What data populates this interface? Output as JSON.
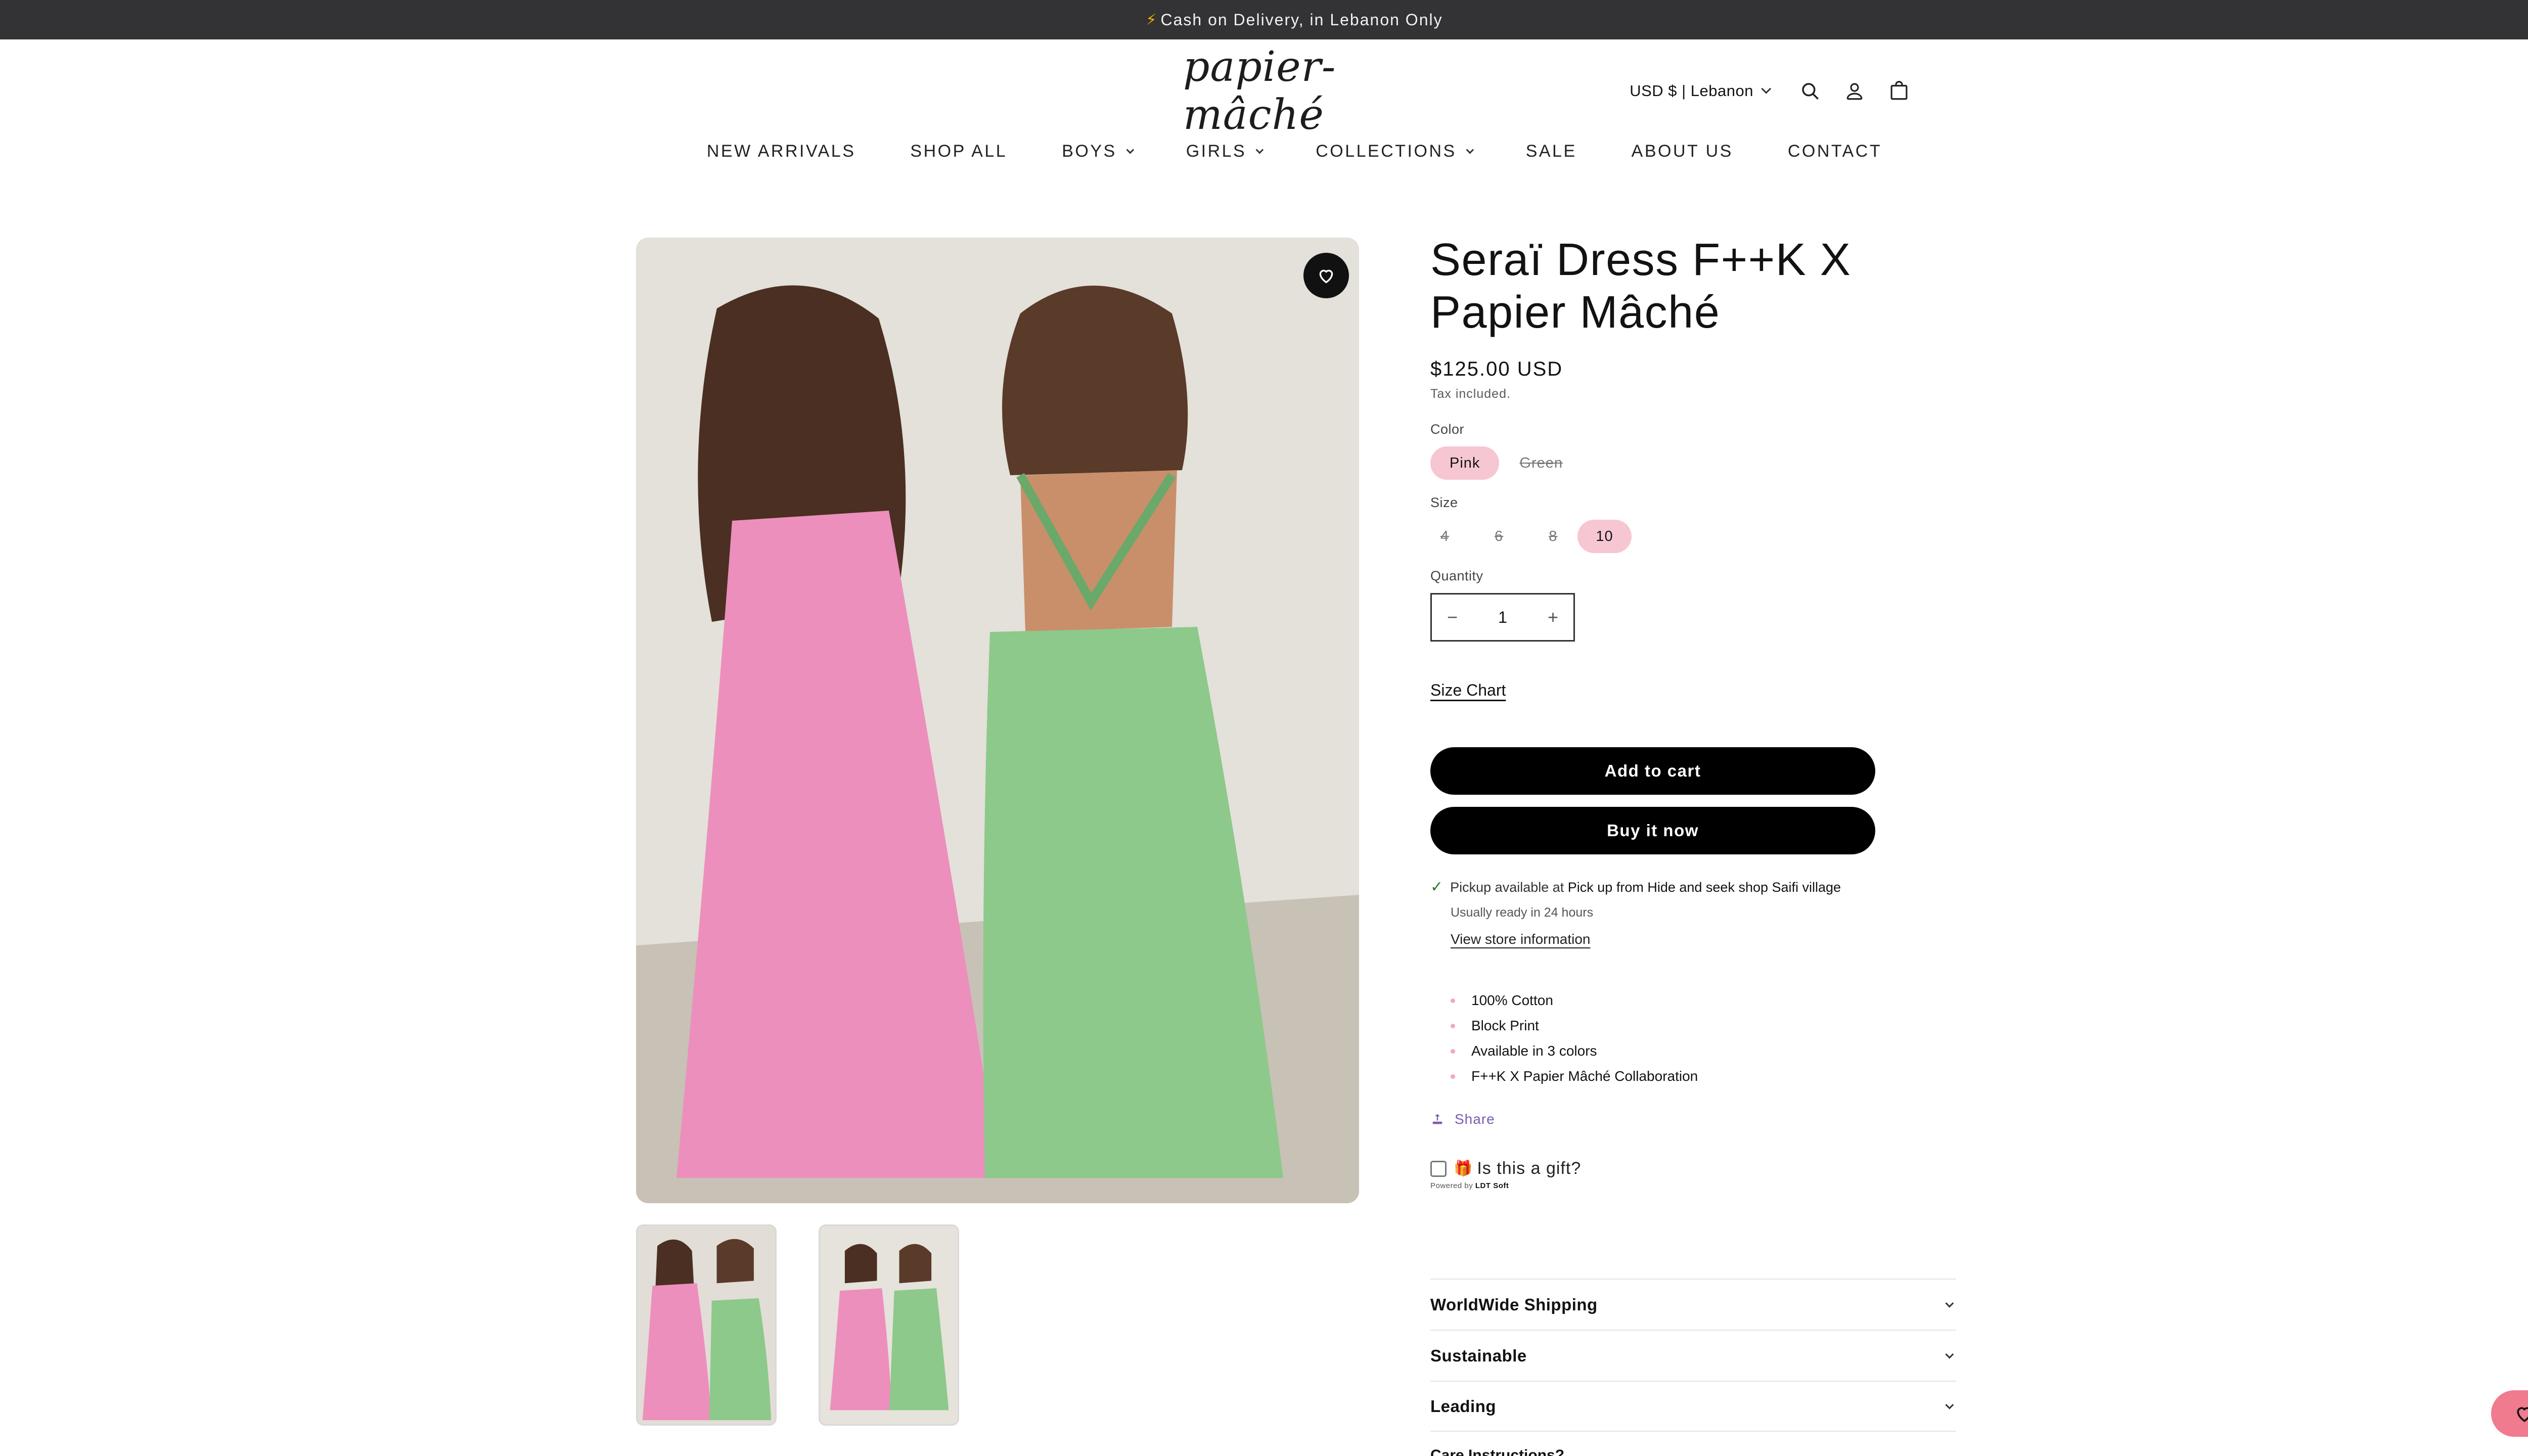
{
  "announcement": {
    "icon": "lightning-icon",
    "text": "Cash on Delivery, in Lebanon Only"
  },
  "header": {
    "logo": "papier-mâché",
    "currency": "USD $ | Lebanon",
    "icons": [
      "search-icon",
      "account-icon",
      "cart-icon"
    ]
  },
  "nav": [
    {
      "label": "NEW ARRIVALS",
      "dropdown": false
    },
    {
      "label": "SHOP ALL",
      "dropdown": false
    },
    {
      "label": "BOYS",
      "dropdown": true
    },
    {
      "label": "GIRLS",
      "dropdown": true
    },
    {
      "label": "COLLECTIONS",
      "dropdown": true
    },
    {
      "label": "SALE",
      "dropdown": false
    },
    {
      "label": "ABOUT US",
      "dropdown": false
    },
    {
      "label": "CONTACT",
      "dropdown": false
    }
  ],
  "product": {
    "title": "Seraï Dress F++K X Papier Mâché",
    "price": "$125.00 USD",
    "tax_note": "Tax included.",
    "color_label": "Color",
    "colors": [
      {
        "label": "Pink",
        "selected": true,
        "available": true
      },
      {
        "label": "Green",
        "selected": false,
        "available": false
      }
    ],
    "size_label": "Size",
    "sizes": [
      {
        "label": "4",
        "selected": false,
        "available": false
      },
      {
        "label": "6",
        "selected": false,
        "available": false
      },
      {
        "label": "8",
        "selected": false,
        "available": false
      },
      {
        "label": "10",
        "selected": true,
        "available": true
      }
    ],
    "quantity_label": "Quantity",
    "quantity": "1",
    "qty_minus": "−",
    "qty_plus": "+",
    "size_chart": "Size Chart",
    "add_to_cart": "Add to cart",
    "buy_now": "Buy it now",
    "pickup_prefix": "Pickup available at ",
    "pickup_location": "Pick up from Hide and seek shop Saifi village",
    "pickup_ready": "Usually ready in 24 hours",
    "store_link": "View store information",
    "features": [
      "100% Cotton",
      "Block Print",
      "Available in 3 colors",
      "F++K X Papier Mâché Collaboration"
    ],
    "share": "Share",
    "gift_emoji": "🎁",
    "gift_label": "Is this a gift?",
    "powered_prefix": "Powered by ",
    "powered_brand": "LDT Soft",
    "accordions": [
      "WorldWide Shipping",
      "Sustainable",
      "Leading"
    ],
    "accordion_partial": "Care Instructions?"
  },
  "colors": {
    "accent_pink": "#f6c6d3",
    "announcement_bg": "#333336",
    "button_bg": "#000000",
    "share_purple": "#7c5cb0",
    "wishlist_pink": "#f07a8e"
  }
}
